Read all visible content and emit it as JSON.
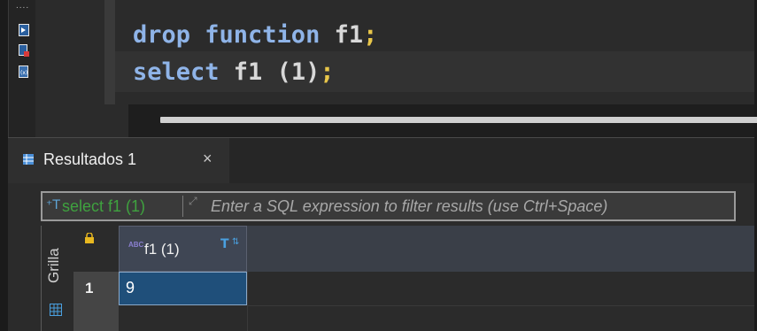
{
  "editor": {
    "line1": {
      "kw": "drop function",
      "ident": " f1",
      "semi": ";"
    },
    "line2": {
      "kw": "select",
      "ident": " f1 (1)",
      "semi": ";"
    }
  },
  "gutter": {
    "dots": "....",
    "icons": [
      "execute-script-icon",
      "stop-icon",
      "variables-icon"
    ]
  },
  "results": {
    "tab_label": "Resultados 1",
    "tab_close": "×",
    "filter": {
      "query": "select f1 (1)",
      "placeholder": "Enter a SQL expression to filter results (use Ctrl+Space)"
    },
    "side_tab": "Grilla",
    "columns": [
      {
        "type_badge": "ABC",
        "label": "f1 (1)"
      }
    ],
    "rows": [
      {
        "num": "1",
        "values": [
          "9"
        ]
      }
    ]
  },
  "colors": {
    "keyword": "#8fb4e8",
    "semicolon": "#e8c64a",
    "filter_query": "#3fa23f",
    "selected_cell": "#1f4f7a"
  }
}
